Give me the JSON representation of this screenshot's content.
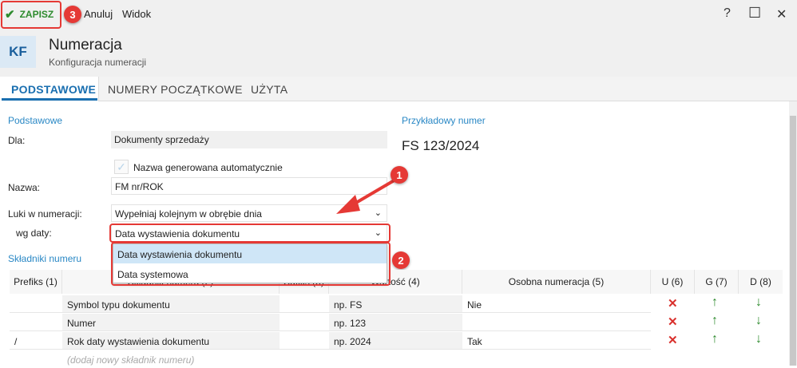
{
  "toolbar": {
    "save_label": "ZAPISZ",
    "cancel_label": "Anuluj",
    "view_label": "Widok",
    "help_label": "?",
    "maximize_label": "☐",
    "close_label": "✕"
  },
  "header": {
    "badge": "KF",
    "title": "Numeracja",
    "subtitle": "Konfiguracja numeracji"
  },
  "tabs": [
    {
      "label": "PODSTAWOWE"
    },
    {
      "label": "NUMERY POCZĄTKOWE"
    },
    {
      "label": "UŻYTA"
    }
  ],
  "basic": {
    "section_title": "Podstawowe",
    "for_label": "Dla:",
    "for_value": "Dokumenty sprzedaży",
    "auto_name_label": "Nazwa generowana automatycznie",
    "name_label": "Nazwa:",
    "name_value": "FM nr/ROK",
    "gaps_label": "Luki w numeracji:",
    "gaps_value": "Wypełniaj kolejnym w obrębie dnia",
    "by_date_label": "wg daty:",
    "by_date_value": "Data wystawienia dokumentu"
  },
  "dropdown": {
    "options": [
      "Data wystawienia dokumentu",
      "Data systemowa"
    ]
  },
  "example": {
    "section_title": "Przykładowy numer",
    "value": "FS 123/2024"
  },
  "components": {
    "section_title": "Składniki numeru",
    "headers": [
      "Prefiks (1)",
      "Składnik numeru (2)",
      "Sufiks (3)",
      "Wartość (4)",
      "Osobna numeracja (5)",
      "U (6)",
      "G (7)",
      "D (8)"
    ],
    "rows": [
      {
        "prefix": "",
        "component": "Symbol typu dokumentu",
        "suffix": "",
        "value": "np. FS",
        "separate": "Nie"
      },
      {
        "prefix": "",
        "component": "Numer",
        "suffix": "",
        "value": "np. 123",
        "separate": ""
      },
      {
        "prefix": "/",
        "component": "Rok daty wystawienia dokumentu",
        "suffix": "",
        "value": "np. 2024",
        "separate": "Tak"
      }
    ],
    "add_placeholder": "(dodaj nowy składnik numeru)"
  },
  "annotations": [
    "1",
    "2",
    "3"
  ],
  "colors": {
    "accent": "#1a6fb0",
    "annotation": "#e53935",
    "section": "#2a88c5"
  }
}
